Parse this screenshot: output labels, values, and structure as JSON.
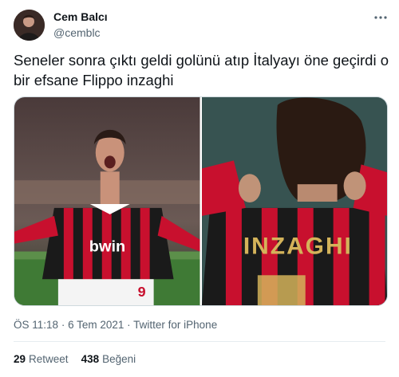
{
  "author": {
    "display_name": "Cem Balcı",
    "handle": "@cemblc"
  },
  "tweet": {
    "text": "Seneler sonra çıktı geldi golünü atıp İtalyayı öne geçirdi o bir efsane Flippo inzaghi",
    "time": "ÖS 11:18",
    "date": "6 Tem 2021",
    "separator": "·",
    "source": "Twitter for iPhone"
  },
  "media": {
    "left_jersey_text": "bwin",
    "left_number": "9",
    "right_jersey_name": "INZAGHI"
  },
  "stats": {
    "retweet_count": "29",
    "retweet_label": "Retweet",
    "like_count": "438",
    "like_label": "Beğeni"
  },
  "icons": {
    "more": "more-dots-icon"
  }
}
